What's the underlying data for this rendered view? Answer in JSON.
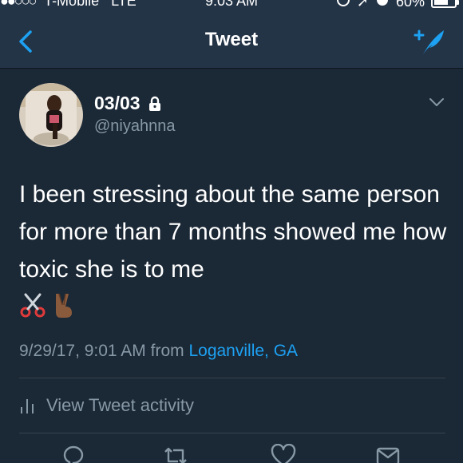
{
  "status_bar": {
    "carrier": "T-Mobile",
    "network": "LTE",
    "time": "9:03 AM",
    "battery_percent": "60%",
    "battery_level": 0.6
  },
  "nav": {
    "title": "Tweet",
    "back_icon": "chevron-left-icon",
    "compose_icon": "compose-tweet-icon"
  },
  "tweet": {
    "display_name": "03/03",
    "handle": "@niyahnna",
    "protected_icon": "lock-icon",
    "text": "I been stressing about the same person for more than 7 months showed me how toxic she is to me",
    "emojis": [
      "scissors-icon",
      "victory-hand-icon"
    ],
    "timestamp": "9/29/17, 9:01 AM from",
    "location": "Loganville, GA"
  },
  "activity": {
    "label": "View Tweet activity",
    "icon": "bar-chart-icon"
  },
  "actions": [
    "reply-icon",
    "retweet-icon",
    "like-icon",
    "share-icon"
  ],
  "colors": {
    "background": "#141d26",
    "bar": "#243447",
    "card": "#1b2836",
    "accent": "#1da1f2",
    "muted": "#8899a6"
  }
}
